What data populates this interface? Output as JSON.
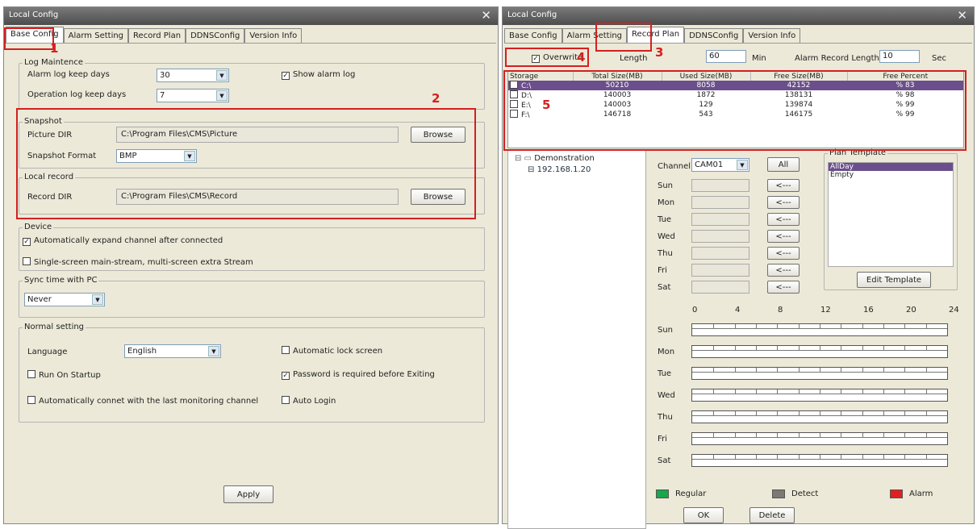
{
  "left": {
    "title": "Local Config",
    "tabs": [
      "Base Config",
      "Alarm Setting",
      "Record Plan",
      "DDNSConfig",
      "Version Info"
    ],
    "log": {
      "legend": "Log Maintence",
      "alarm_label": "Alarm log keep days",
      "alarm_val": "30",
      "op_label": "Operation log keep days",
      "op_val": "7",
      "show_alarm": "Show alarm log"
    },
    "snapshot": {
      "legend": "Snapshot",
      "dir_label": "Picture DIR",
      "dir_val": "C:\\Program Files\\CMS\\Picture",
      "browse": "Browse",
      "fmt_label": "Snapshot Format",
      "fmt_val": "BMP"
    },
    "localrec": {
      "legend": "Local record",
      "dir_label": "Record DIR",
      "dir_val": "C:\\Program Files\\CMS\\Record",
      "browse": "Browse"
    },
    "device": {
      "legend": "Device",
      "expand": "Automatically expand channel after connected",
      "single": "Single-screen main-stream, multi-screen extra Stream"
    },
    "sync": {
      "legend": "Sync time with PC",
      "val": "Never"
    },
    "normal": {
      "legend": "Normal setting",
      "lang_label": "Language",
      "lang_val": "English",
      "autolock": "Automatic lock screen",
      "run": "Run On Startup",
      "pwd": "Password is required before Exiting",
      "autoconn": "Automatically connet with the last monitoring channel",
      "autologin": "Auto Login"
    },
    "apply": "Apply"
  },
  "right": {
    "title": "Local Config",
    "tabs": [
      "Base Config",
      "Alarm Setting",
      "Record Plan",
      "DDNSConfig",
      "Version Info"
    ],
    "overwrite": "Overwrite",
    "length_label": "Length",
    "length_val": "60",
    "min": "Min",
    "alarm_len_label": "Alarm Record Length",
    "alarm_len_val": "10",
    "sec": "Sec",
    "storage_cols": [
      "Storage",
      "Total Size(MB)",
      "Used Size(MB)",
      "Free Size(MB)",
      "Free Percent"
    ],
    "storage_rows": [
      [
        "C:\\",
        "50210",
        "8058",
        "42152",
        "% 83"
      ],
      [
        "D:\\",
        "140003",
        "1872",
        "138131",
        "% 98"
      ],
      [
        "E:\\",
        "140003",
        "129",
        "139874",
        "% 99"
      ],
      [
        "F:\\",
        "146718",
        "543",
        "146175",
        "% 99"
      ]
    ],
    "tree_root": "Demonstration",
    "tree_child": "192.168.1.20",
    "channel_label": "Channel",
    "channel_val": "CAM01",
    "all": "All",
    "arrow": "<---",
    "days": [
      "Sun",
      "Mon",
      "Tue",
      "Wed",
      "Thu",
      "Fri",
      "Sat"
    ],
    "plan_legend": "Plan Template",
    "plans": [
      "AllDay",
      "Empty"
    ],
    "edit_template": "Edit Template",
    "hours": [
      "0",
      "4",
      "8",
      "12",
      "16",
      "20",
      "24"
    ],
    "legend_items": [
      {
        "label": "Regular",
        "color": "#1aa64a"
      },
      {
        "label": "Detect",
        "color": "#7a7a72"
      },
      {
        "label": "Alarm",
        "color": "#e02020"
      }
    ],
    "ok": "OK",
    "delete": "Delete"
  },
  "annotations": [
    "1",
    "2",
    "3",
    "4",
    "5"
  ]
}
